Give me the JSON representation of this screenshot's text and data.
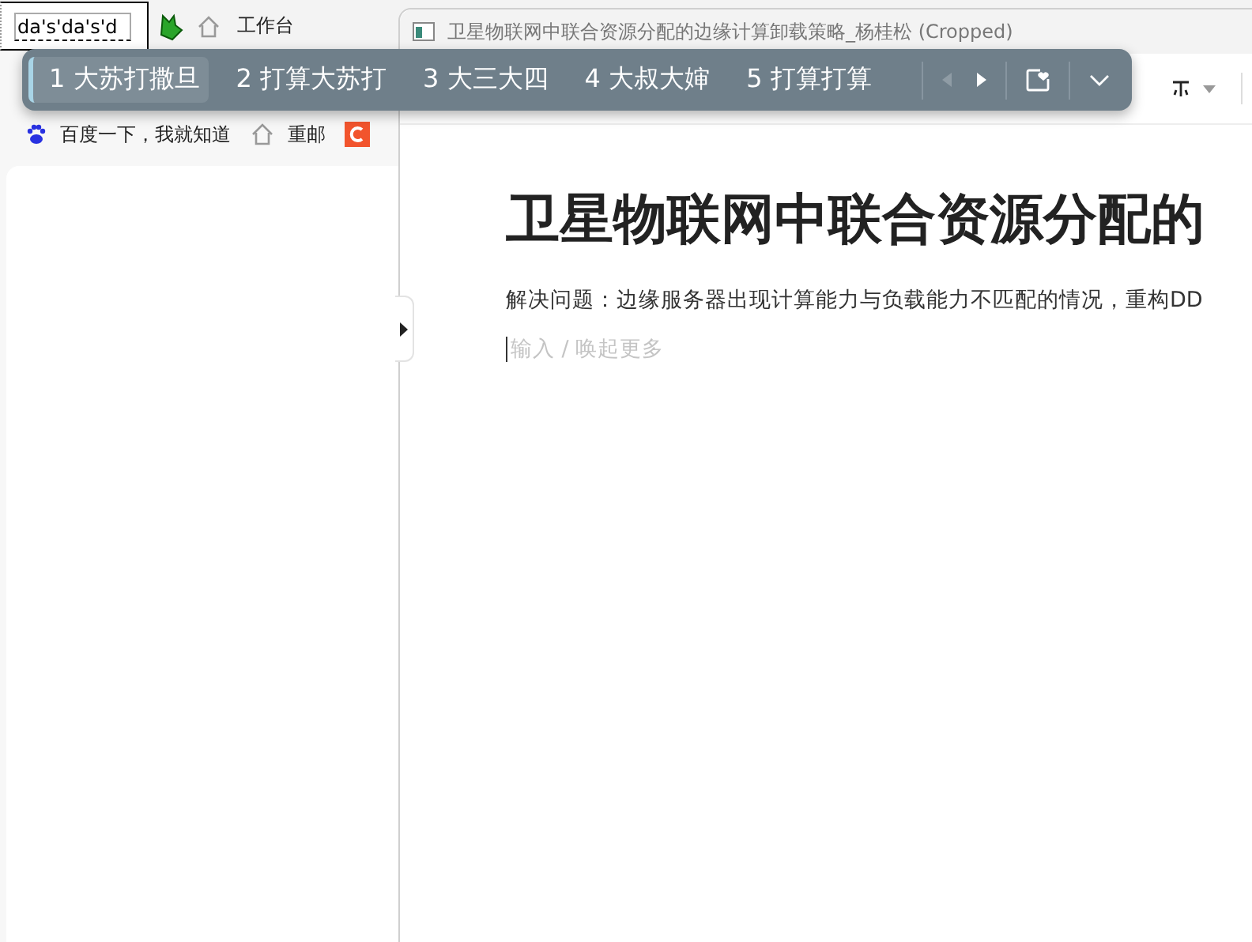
{
  "browser": {
    "composition": {
      "value": "da's'da's'd"
    },
    "top_link": "工作台",
    "bookmarks": [
      {
        "kind": "baidu",
        "label": "百度一下，我就知道"
      },
      {
        "kind": "home",
        "label": "重邮"
      },
      {
        "kind": "c"
      }
    ]
  },
  "window": {
    "title": "卫星物联网中联合资源分配的边缘计算卸载策略_杨桂松 (Cropped)"
  },
  "document": {
    "heading": "卫星物联网中联合资源分配的",
    "paragraph": "解决问题：边缘服务器出现计算能力与负载能力不匹配的情况，重构DD",
    "placeholder": "输入 / 唤起更多"
  },
  "ime": {
    "candidates": [
      {
        "label": "1 大苏打撒旦",
        "selected": true
      },
      {
        "label": "2 打算大苏打",
        "selected": false
      },
      {
        "label": "3 大三大四",
        "selected": false
      },
      {
        "label": "4 大叔大婶",
        "selected": false
      },
      {
        "label": "5 打算打算",
        "selected": false
      }
    ],
    "prev_disabled": true,
    "next_disabled": false
  }
}
